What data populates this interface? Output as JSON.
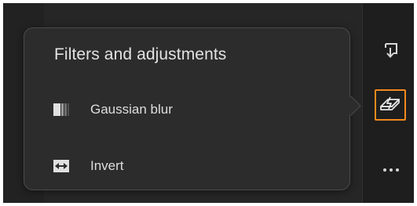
{
  "popover": {
    "title": "Filters and adjustments",
    "items": [
      {
        "label": "Gaussian blur",
        "icon": "gaussian-blur-icon"
      },
      {
        "label": "Invert",
        "icon": "invert-icon"
      }
    ]
  },
  "toolbar": {
    "tools": [
      {
        "icon": "export-icon",
        "active": false
      },
      {
        "icon": "filters-adjustments-icon",
        "active": true
      },
      {
        "icon": "more-icon",
        "active": false
      }
    ]
  },
  "colors": {
    "accent_active": "#f28a1d",
    "panel_bg": "#2c2c2c",
    "canvas_bg": "#262626",
    "toolbar_bg": "#1e1e1e",
    "text": "#e3e3e3"
  }
}
